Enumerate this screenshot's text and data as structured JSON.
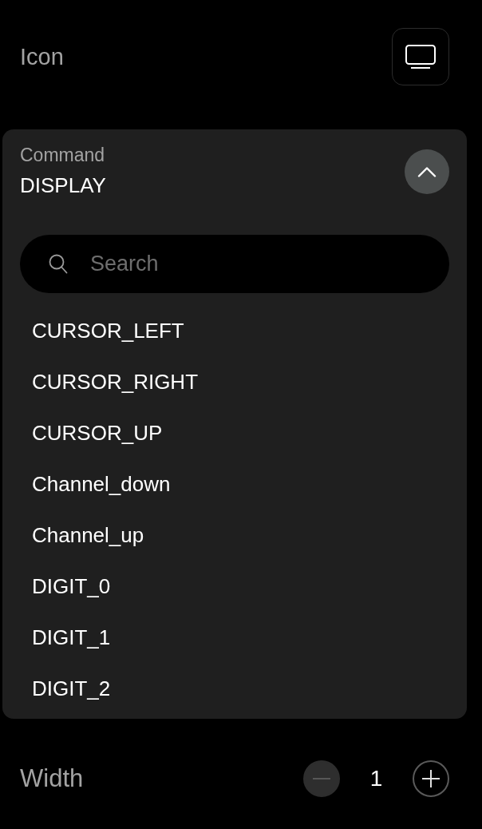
{
  "icon_row": {
    "label": "Icon"
  },
  "command": {
    "label": "Command",
    "value": "DISPLAY",
    "expanded": true,
    "search": {
      "placeholder": "Search"
    },
    "options": [
      "CURSOR_LEFT",
      "CURSOR_RIGHT",
      "CURSOR_UP",
      "Channel_down",
      "Channel_up",
      "DIGIT_0",
      "DIGIT_1",
      "DIGIT_2"
    ]
  },
  "width": {
    "label": "Width",
    "value": "1",
    "decrement_disabled": true,
    "increment_disabled": false
  }
}
